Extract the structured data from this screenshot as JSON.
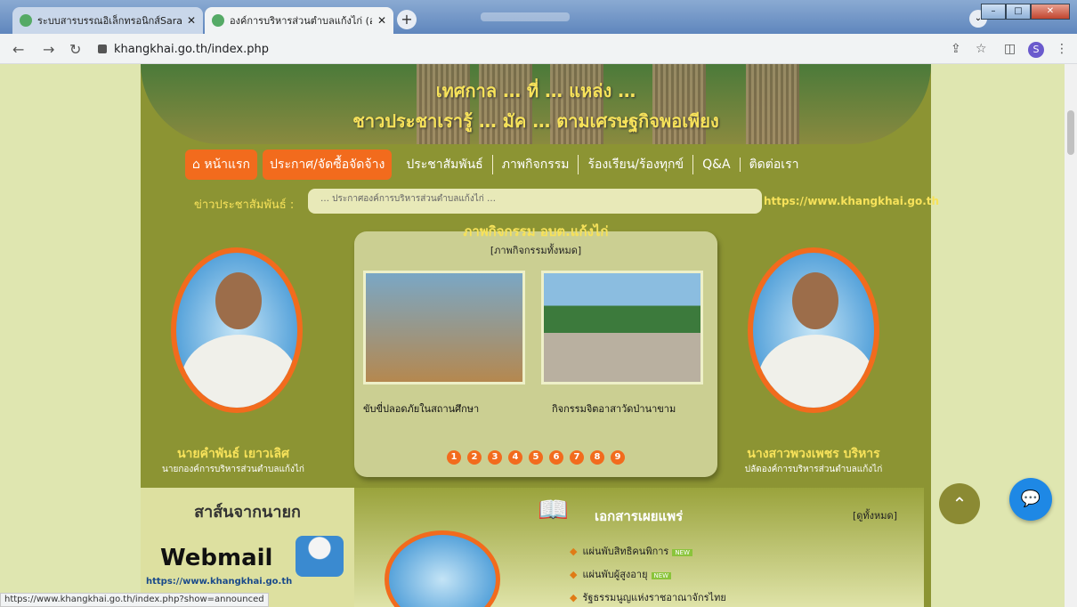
{
  "browser": {
    "tabs": [
      {
        "label": "ระบบสารบรรณอิเล็กทรอนิกส์Saraban",
        "active": false
      },
      {
        "label": "องค์การบริหารส่วนตำบลแก้งไก่ (อบต.แ",
        "active": true
      }
    ],
    "new_tab": "+",
    "url": "khangkhai.go.th/index.php",
    "profile_initial": "S"
  },
  "site": {
    "banner_line1": "เทศกาล … ที่ … แหล่ง …",
    "banner_line2": "ชาวประชาเรารู้ … มัค … ตามเศรษฐกิจพอเพียง",
    "menu": [
      {
        "label": "หน้าแรก",
        "highlight": true
      },
      {
        "label": "ประกาศ/จัดซื้อจัดจ้าง",
        "highlight": true
      },
      {
        "label": "ประชาสัมพันธ์",
        "highlight": false
      },
      {
        "label": "ภาพกิจกรรม",
        "highlight": false
      },
      {
        "label": "ร้องเรียน/ร้องทุกข์",
        "highlight": false
      },
      {
        "label": "Q&A",
        "highlight": false
      },
      {
        "label": "ติดต่อเรา",
        "highlight": false
      }
    ],
    "news_label": "ข่าวประชาสัมพันธ์ :",
    "news_ticker": "… ประกาศองค์การบริหารส่วนตำบลแก้งไก่ …",
    "news_url": "https://www.khangkhai.go.th",
    "left_person": {
      "name": "นายคำพันธ์ เยาวเลิศ",
      "role": "นายกองค์การบริหารส่วนตำบลแก้งไก่"
    },
    "right_person": {
      "name": "นางสาวพวงเพชร บริหาร",
      "role": "ปลัดองค์การบริหารส่วนตำบลแก้งไก่"
    },
    "gallery": {
      "title": "ภาพกิจกรรม อบต.แก้งไก่",
      "subtitle": "[ภาพกิจกรรมทั้งหมด]",
      "captions": [
        "ขับขี่ปลอดภัยในสถานศึกษา",
        "กิจกรรมจิตอาสาวัดป่านาขาม"
      ],
      "pages": [
        "1",
        "2",
        "3",
        "4",
        "5",
        "6",
        "7",
        "8",
        "9"
      ]
    },
    "message_title": "สาส์นจากนายก",
    "webmail": {
      "label": "Webmail",
      "url": "https://www.khangkhai.go.th"
    },
    "documents": {
      "title": "เอกสารเผยแพร่",
      "view_all": "[ดูทั้งหมด]",
      "items": [
        "แผ่นพับสิทธิคนพิการ",
        "แผ่นพับผู้สูงอายุ",
        "รัฐธรรมนูญแห่งราชอาณาจักรไทย"
      ],
      "new_badge": "NEW"
    }
  },
  "status_url": "https://www.khangkhai.go.th/index.php?show=announced",
  "colors": {
    "accent_orange": "#f26b1d",
    "olive": "#8c9433",
    "title_yellow": "#f7e25a"
  }
}
